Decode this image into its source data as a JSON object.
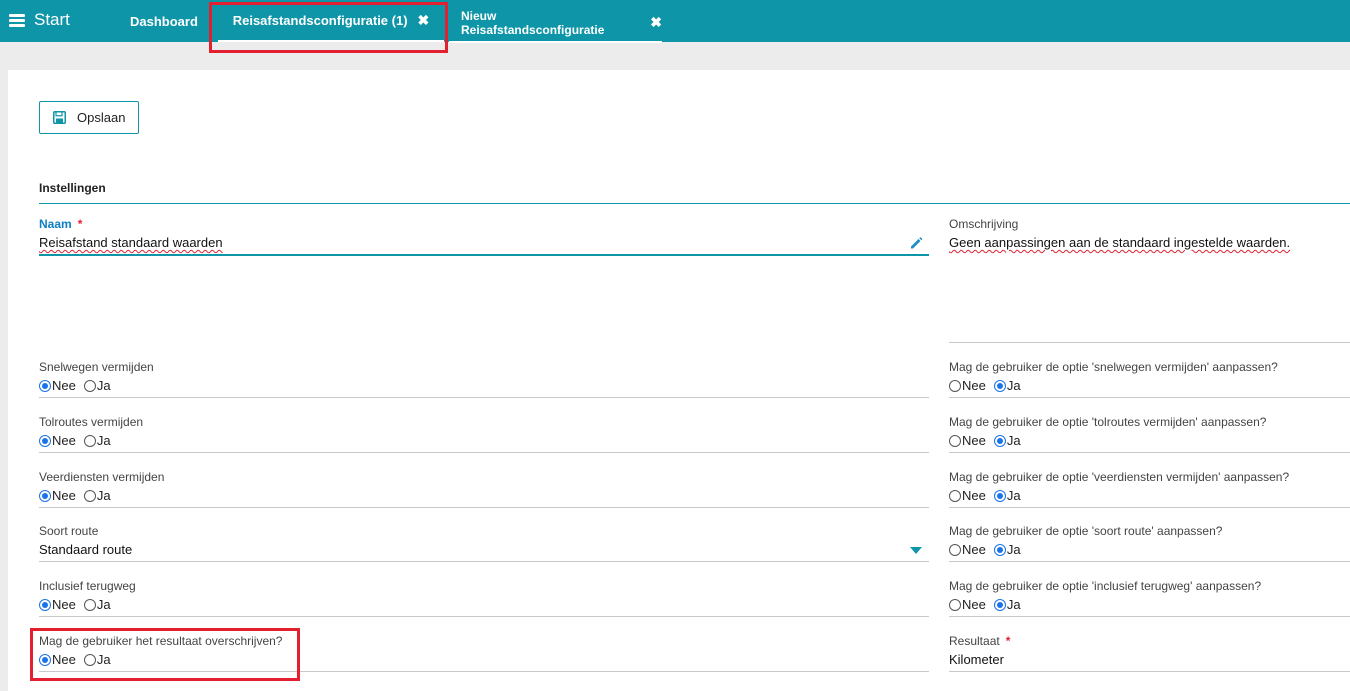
{
  "menu": {
    "label": "Start",
    "icon": "hamburger-icon"
  },
  "tabs": {
    "dashboard": "Dashboard",
    "active": {
      "label": "Reisafstandsconfiguratie (1)",
      "close": "✖"
    },
    "new": {
      "label": "Nieuw Reisafstandsconfiguratie",
      "close": "✖"
    }
  },
  "toolbar": {
    "save_label": "Opslaan",
    "save_icon": "floppy-disk-icon"
  },
  "section": {
    "title": "Instellingen"
  },
  "form": {
    "naam": {
      "label": "Naam",
      "required": "*",
      "value": "Reisafstand standaard waarden"
    },
    "omschrijving": {
      "label": "Omschrijving",
      "value": "Geen aanpassingen aan de standaard ingestelde waarden."
    },
    "options": {
      "nee": "Nee",
      "ja": "Ja"
    },
    "snelwegen": {
      "label": "Snelwegen vermijden",
      "selected": "Nee"
    },
    "snelwegen_user": {
      "label": "Mag de gebruiker de optie 'snelwegen vermijden' aanpassen?",
      "selected": "Ja"
    },
    "tolroutes": {
      "label": "Tolroutes vermijden",
      "selected": "Nee"
    },
    "tolroutes_user": {
      "label": "Mag de gebruiker de optie 'tolroutes vermijden' aanpassen?",
      "selected": "Ja"
    },
    "veerdiensten": {
      "label": "Veerdiensten vermijden",
      "selected": "Nee"
    },
    "veerdiensten_user": {
      "label": "Mag de gebruiker de optie 'veerdiensten vermijden' aanpassen?",
      "selected": "Ja"
    },
    "soort_route": {
      "label": "Soort route",
      "value": "Standaard route"
    },
    "soort_route_user": {
      "label": "Mag de gebruiker de optie 'soort route' aanpassen?",
      "selected": "Ja"
    },
    "terugweg": {
      "label": "Inclusief terugweg",
      "selected": "Nee"
    },
    "terugweg_user": {
      "label": "Mag de gebruiker de optie 'inclusief terugweg' aanpassen?",
      "selected": "Ja"
    },
    "overschrijven": {
      "label": "Mag de gebruiker het resultaat overschrijven?",
      "selected": "Nee"
    },
    "resultaat": {
      "label": "Resultaat",
      "required": "*",
      "value": "Kilometer"
    }
  },
  "colors": {
    "accent": "#0e96a8",
    "highlight": "#e3202f",
    "radio": "#1a73e8"
  }
}
